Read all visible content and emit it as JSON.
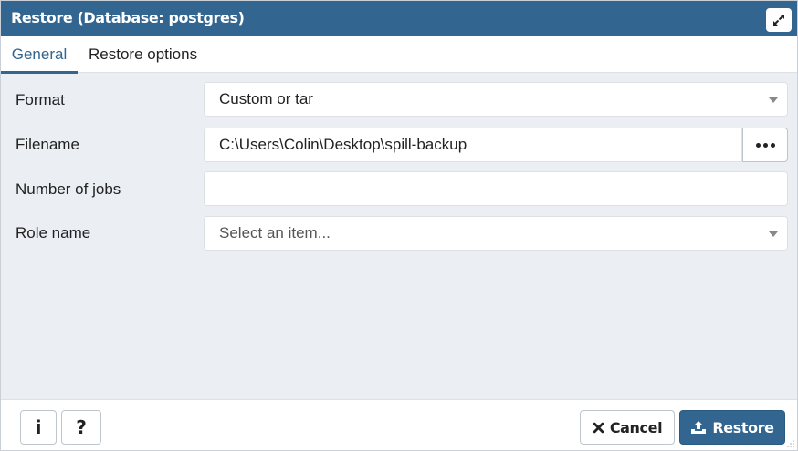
{
  "dialog": {
    "title": "Restore (Database: postgres)",
    "maximize_icon": "expand-arrows-icon"
  },
  "tabs": [
    {
      "label": "General",
      "active": true
    },
    {
      "label": "Restore options",
      "active": false
    }
  ],
  "form": {
    "format": {
      "label": "Format",
      "value": "Custom or tar"
    },
    "filename": {
      "label": "Filename",
      "value": "C:\\Users\\Colin\\Desktop\\spill-backup",
      "browse_icon": "ellipsis-icon"
    },
    "jobs": {
      "label": "Number of jobs",
      "value": ""
    },
    "role": {
      "label": "Role name",
      "placeholder": "Select an item..."
    }
  },
  "footer": {
    "info_label": "i",
    "help_label": "?",
    "cancel_label": "Cancel",
    "restore_label": "Restore"
  },
  "colors": {
    "accent": "#326690",
    "background": "#ebeef3"
  }
}
